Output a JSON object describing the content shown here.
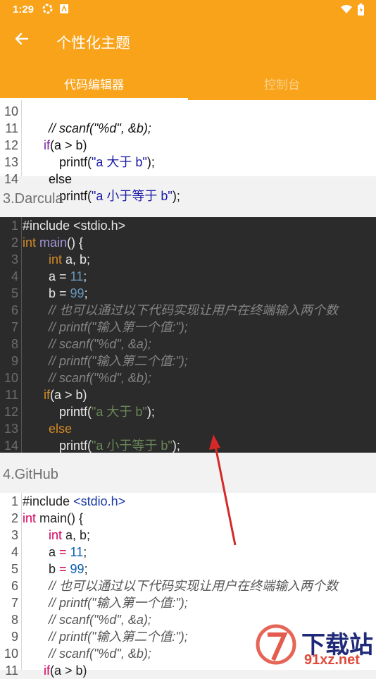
{
  "status": {
    "time": "1:29"
  },
  "appbar": {
    "title": "个性化主题"
  },
  "tabs": [
    {
      "label": "代码编辑器"
    },
    {
      "label": "控制台"
    }
  ],
  "themes": [
    {
      "title": "3.Darcula"
    },
    {
      "title": "4.GitHub"
    }
  ],
  "code_top": {
    "num_10": "10",
    "line_10": "// scanf(\"%d\", &b);",
    "num_11": "11",
    "num_12": "12",
    "num_13": "13",
    "num_14": "14"
  },
  "code": {
    "n1": "1",
    "n2": "2",
    "n3": "3",
    "n4": "4",
    "n5": "5",
    "n6": "6",
    "n7": "7",
    "n8": "8",
    "n9": "9",
    "n10": "10",
    "n11": "11",
    "n12": "12",
    "n13": "13",
    "n14": "14",
    "include": "#include <stdio.h>",
    "include_kw": "#include",
    "include_file": " <stdio.h>",
    "int": "int",
    "main": " main",
    "main_paren": "() {",
    "ab": " a, b;",
    "a": "a",
    "eq": " = ",
    "eleven": "11",
    "semi": ";",
    "b": "b",
    "ninetynine": "99",
    "comment6": "// 也可以通过以下代码实现让用户在终端输入两个数",
    "comment7": "// printf(\"输入第一个值:\");",
    "comment8": "// scanf(\"%d\", &a);",
    "comment9": "// printf(\"输入第二个值:\");",
    "comment10": "// scanf(\"%d\", &b);",
    "if": "if",
    "cond": "(a > b)",
    "printf": "printf(",
    "str_big": "\"a 大于 b\"",
    "str_small": "\"a 小于等于 b\"",
    "close": ");",
    "else": "else"
  },
  "watermark": {
    "text": "下载站",
    "sub": "91xz.net"
  },
  "colors": {
    "accent": "#f9a31b",
    "darcula_bg": "#2b2b2b",
    "arrow": "#d62828"
  }
}
